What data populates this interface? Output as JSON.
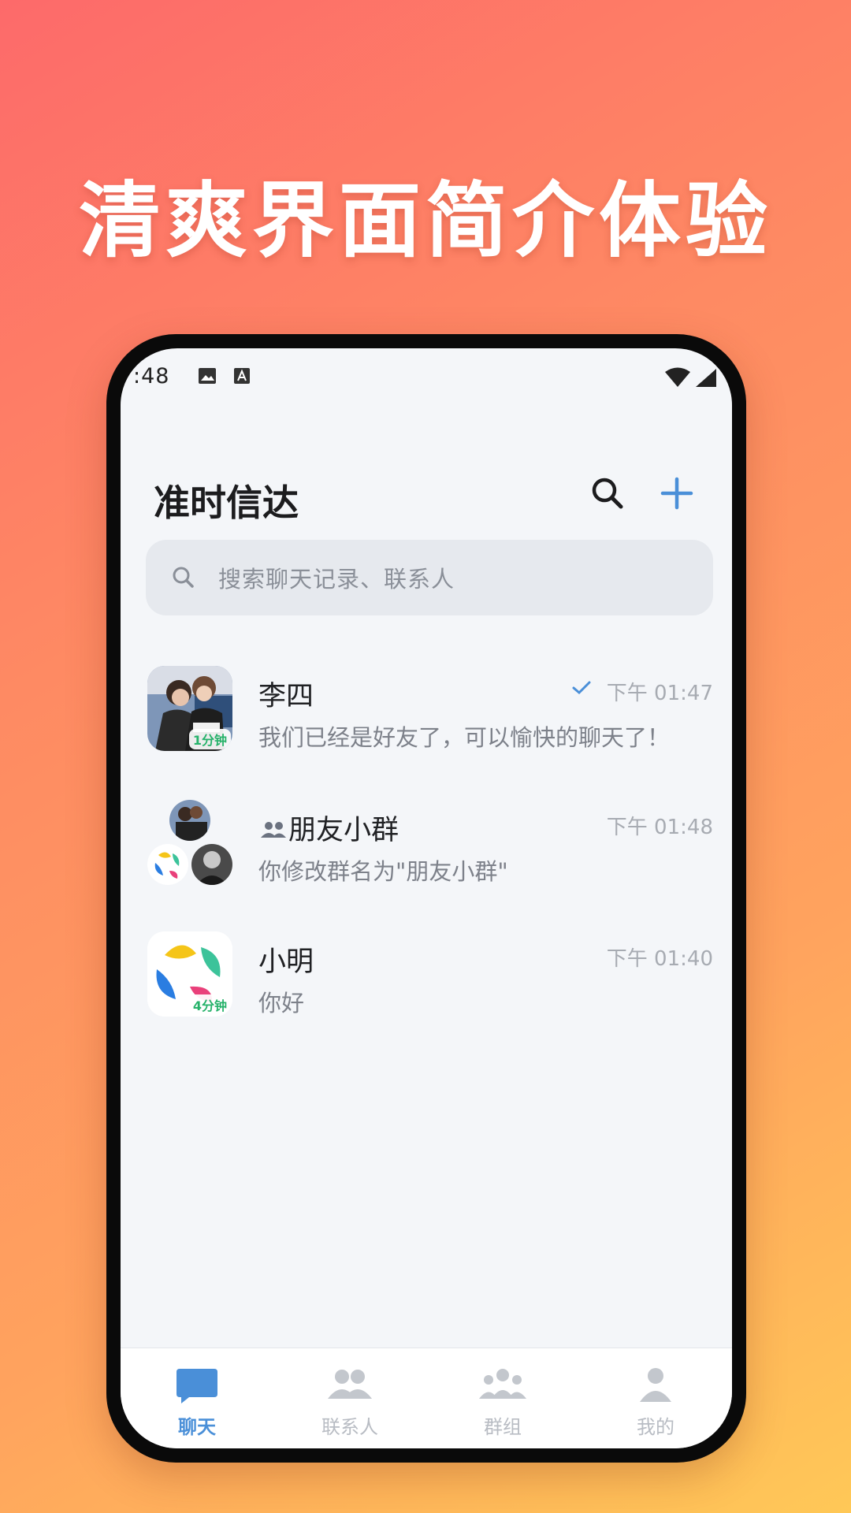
{
  "headline": "清爽界面简介体验",
  "status_bar": {
    "time": ":48"
  },
  "header": {
    "title": "准时信达",
    "search_icon": "search-icon",
    "add_icon": "plus-icon"
  },
  "search": {
    "placeholder": "搜索聊天记录、联系人"
  },
  "conversations": [
    {
      "name": "李四",
      "message": "我们已经是好友了，可以愉快的聊天了！",
      "time": "下午 01:47",
      "badge": "1分钟",
      "read": true
    },
    {
      "name": "朋友小群",
      "message": "你修改群名为\"朋友小群\"",
      "time": "下午 01:48",
      "is_group": true
    },
    {
      "name": "小明",
      "message": "你好",
      "time": "下午 01:40",
      "badge": "4分钟"
    }
  ],
  "bottom_nav": [
    {
      "label": "聊天",
      "icon": "chat-bubble-icon",
      "active": true
    },
    {
      "label": "联系人",
      "icon": "contacts-icon"
    },
    {
      "label": "群组",
      "icon": "group-icon"
    },
    {
      "label": "我的",
      "icon": "person-icon"
    }
  ],
  "colors": {
    "accent": "#4a8fd8",
    "badge_green": "#26b26a",
    "inactive": "#b8bcc3"
  }
}
